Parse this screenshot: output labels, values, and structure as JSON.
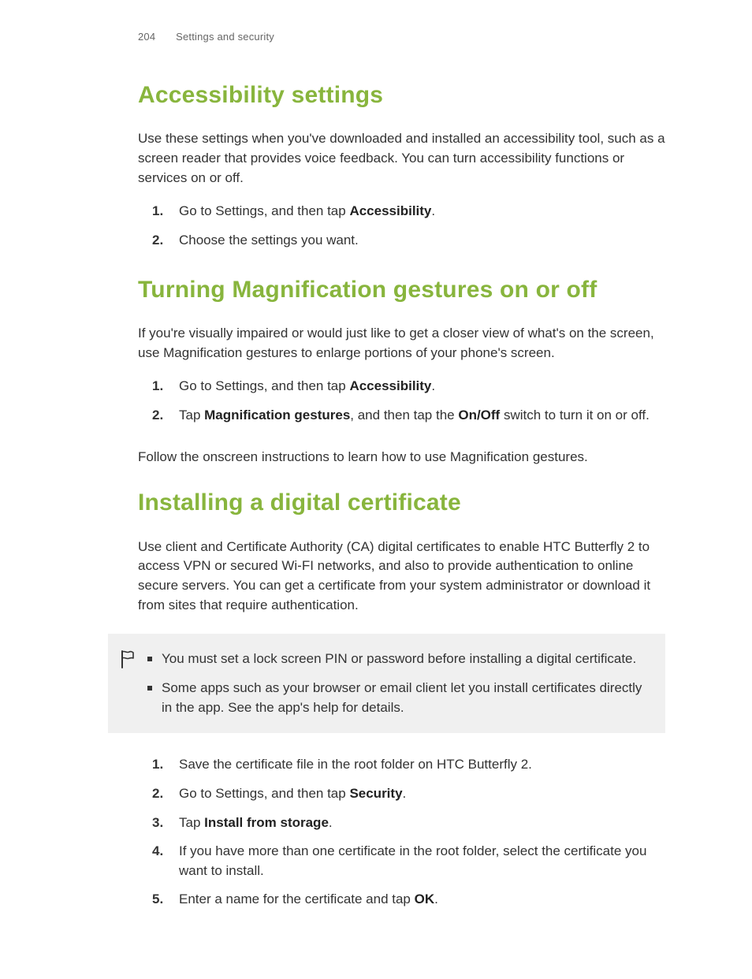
{
  "header": {
    "page_number": "204",
    "section": "Settings and security"
  },
  "section1": {
    "heading": "Accessibility settings",
    "intro": "Use these settings when you've downloaded and installed an accessibility tool, such as a screen reader that provides voice feedback. You can turn accessibility functions or services on or off.",
    "steps": [
      {
        "pre": "Go to Settings, and then tap ",
        "bold": "Accessibility",
        "post": "."
      },
      {
        "pre": "Choose the settings you want.",
        "bold": "",
        "post": ""
      }
    ]
  },
  "section2": {
    "heading": "Turning Magnification gestures on or off",
    "intro": "If you're visually impaired or would just like to get a closer view of what's on the screen, use Magnification gestures to enlarge portions of your phone's screen.",
    "steps": [
      {
        "pre": "Go to Settings, and then tap ",
        "bold": "Accessibility",
        "post": "."
      },
      {
        "parts": [
          {
            "t": "Tap ",
            "b": false
          },
          {
            "t": "Magnification gestures",
            "b": true
          },
          {
            "t": ", and then tap the ",
            "b": false
          },
          {
            "t": "On/Off",
            "b": true
          },
          {
            "t": " switch to turn it on or off.",
            "b": false
          }
        ]
      }
    ],
    "outro": "Follow the onscreen instructions to learn how to use Magnification gestures."
  },
  "section3": {
    "heading": "Installing a digital certificate",
    "intro": "Use client and Certificate Authority (CA) digital certificates to enable HTC Butterfly 2 to access VPN or secured Wi-FI networks, and also to provide authentication to online secure servers. You can get a certificate from your system administrator or download it from sites that require authentication.",
    "callout": [
      "You must set a lock screen PIN or password before installing a digital certificate.",
      "Some apps such as your browser or email client let you install certificates directly in the app. See the app's help for details."
    ],
    "steps": [
      {
        "pre": "Save the certificate file in the root folder on HTC Butterfly 2.",
        "bold": "",
        "post": ""
      },
      {
        "pre": "Go to Settings, and then tap ",
        "bold": "Security",
        "post": "."
      },
      {
        "pre": "Tap ",
        "bold": "Install from storage",
        "post": "."
      },
      {
        "pre": "If you have more than one certificate in the root folder, select the certificate you want to install.",
        "bold": "",
        "post": ""
      },
      {
        "pre": "Enter a name for the certificate and tap ",
        "bold": "OK",
        "post": "."
      }
    ]
  }
}
